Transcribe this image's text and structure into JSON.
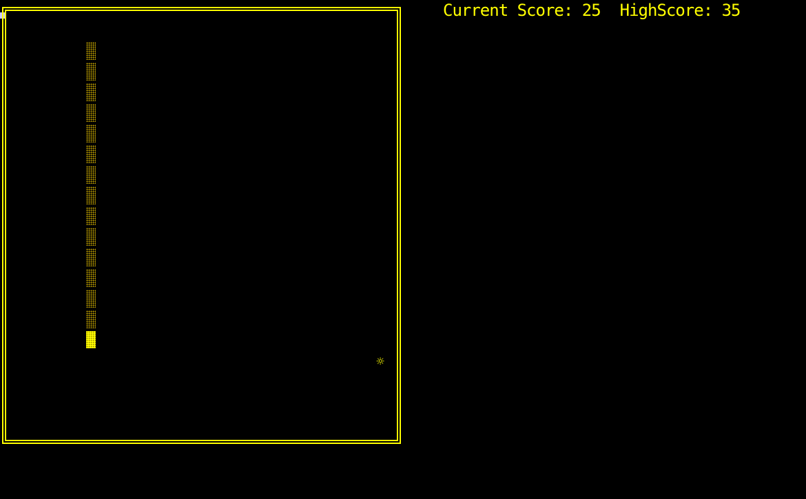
{
  "hud": {
    "current_score_label": "Current Score:",
    "current_score": "25",
    "high_score_label": "HighScore:",
    "high_score": "35"
  },
  "board": {
    "border_style": "double-line",
    "color": "#ffff00"
  },
  "snake": {
    "direction": "down",
    "body_color": "#c8a800",
    "head_color": "#ffff00",
    "length": 15
  },
  "food": {
    "glyph": "☼",
    "icon": "sun-icon"
  },
  "colors": {
    "background": "#000000",
    "accent": "#ffff00"
  }
}
